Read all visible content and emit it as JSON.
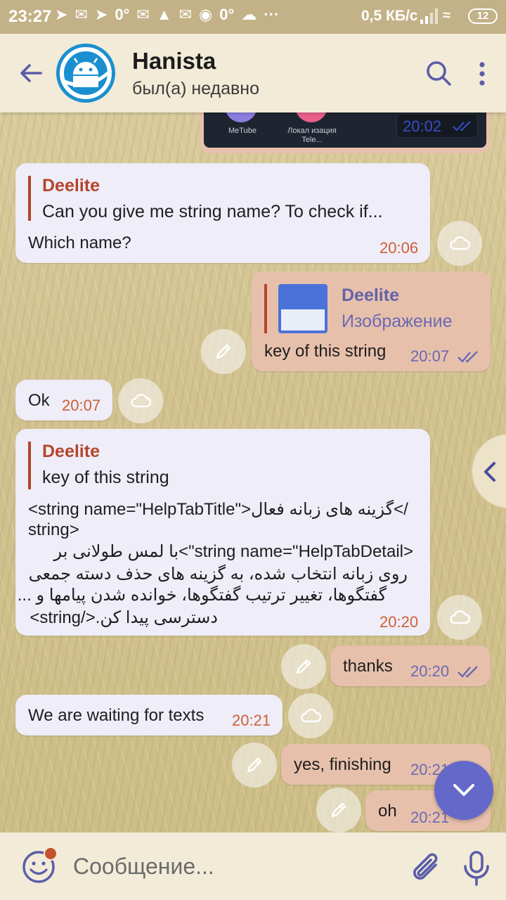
{
  "status_bar": {
    "time": "23:27",
    "speed": "0,5 КБ/с",
    "battery": "12",
    "icons": [
      "telegram-icon",
      "mail-icon",
      "telegram-icon",
      "degree-icon",
      "mail-muted-icon",
      "gamepad-icon",
      "mail-muted-icon",
      "donut-icon",
      "degree-icon",
      "cloud-icon",
      "more-dots-icon"
    ]
  },
  "header": {
    "name": "Hanista",
    "status": "был(а) недавно"
  },
  "top_image": {
    "label_1": "MeTube",
    "label_2": "Локал изация Tele...",
    "time": "20:02"
  },
  "messages": [
    {
      "id": "m1",
      "direction": "in",
      "reply_name": "Deelite",
      "reply_text": "Can you give me string name? To check if...",
      "text": "Which  name?",
      "time": "20:06"
    },
    {
      "id": "m2",
      "direction": "out",
      "reply_name": "Deelite",
      "reply_text": "Изображение",
      "text": "key of this string",
      "time": "20:07"
    },
    {
      "id": "m3",
      "direction": "in",
      "text": "Ok",
      "time": "20:07"
    },
    {
      "id": "m4",
      "direction": "in",
      "reply_name": "Deelite",
      "reply_text": "key of this string",
      "lines": [
        "<string name=\"HelpTabTitle\">گزینه های زبانه فعال</",
        "string>",
        "<string name=\"HelpTabDetail\">با لمس طولانی بر",
        "روی زبانه انتخاب شده، به گزینه های حذف دسته جمعی",
        "گفتگوها، تغییر ترتیب گفتگوها، خوانده شدن پیامها و ...",
        "دسترسی پیدا کن.</string>"
      ],
      "time": "20:20"
    },
    {
      "id": "m5",
      "direction": "out",
      "text": "thanks",
      "time": "20:20"
    },
    {
      "id": "m6",
      "direction": "in",
      "text": "We are waiting for texts",
      "time": "20:21"
    },
    {
      "id": "m7",
      "direction": "out",
      "text": "yes, finishing",
      "time": "20:21"
    },
    {
      "id": "m8",
      "direction": "out",
      "text": "oh",
      "time": "20:21"
    }
  ],
  "input": {
    "placeholder": "Сообщение..."
  },
  "colors": {
    "header_bg": "#f2ebd8",
    "incoming_bubble": "#eeedf8",
    "outgoing_bubble": "#e7c0ac",
    "accent": "#6468c8",
    "reply_name": "#b5452a",
    "time_in": "#d05f36"
  }
}
